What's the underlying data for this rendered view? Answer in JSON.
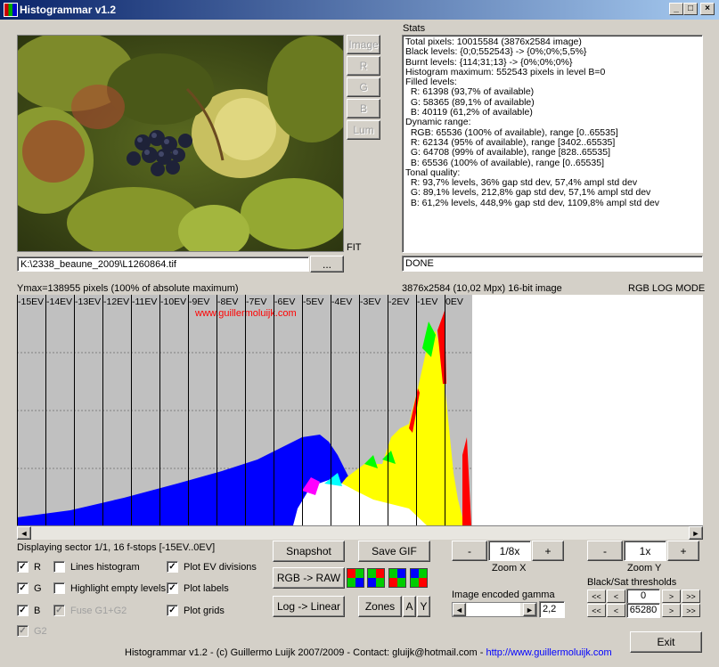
{
  "window": {
    "title": "Histogrammar v1.2",
    "controls": {
      "minimize": "_",
      "maximize": "□",
      "close": "×"
    }
  },
  "preview": {
    "side_buttons": [
      "Image",
      "R",
      "G",
      "B",
      "Lum"
    ],
    "fit_label": "FIT",
    "file_path": "K:\\2338_beaune_2009\\L1260864.tif",
    "browse_label": "..."
  },
  "stats": {
    "heading": "Stats",
    "lines": [
      "Total pixels: 10015584 (3876x2584 image)",
      "Black levels: {0;0;552543} -> {0%;0%;5,5%}",
      "Burnt levels: {114;31;13} -> {0%;0%;0%}",
      "Histogram maximum: 552543 pixels in level B=0",
      "",
      "Filled levels:",
      "  R: 61398 (93,7% of available)",
      "  G: 58365 (89,1% of available)",
      "  B: 40119 (61,2% of available)",
      "Dynamic range:",
      "  RGB: 65536 (100% of available), range [0..65535]",
      "  R: 62134 (95% of available), range [3402..65535]",
      "  G: 64708 (99% of available), range [828..65535]",
      "  B: 65536 (100% of available), range [0..65535]",
      "Tonal quality:",
      "  R: 93,7% levels, 36% gap std dev, 57,4% ampl std dev",
      "  G: 89,1% levels, 212,8% gap std dev, 57,1% ampl std dev",
      "  B: 61,2% levels, 448,9% gap std dev, 1109,8% ampl std dev"
    ],
    "status": "DONE"
  },
  "histogram": {
    "ymax_text": "Ymax=138955 pixels (100% of absolute maximum)",
    "image_info": "3876x2584 (10,02 Mpx) 16-bit image",
    "mode": "RGB LOG MODE",
    "watermark": "www.guillermoluijk.com",
    "ev_labels": [
      "-15EV",
      "-14EV",
      "-13EV",
      "-12EV",
      "-11EV",
      "-10EV",
      "-9EV",
      "-8EV",
      "-7EV",
      "-6EV",
      "-5EV",
      "-4EV",
      "-3EV",
      "-2EV",
      "-1EV",
      "0EV"
    ],
    "sector_text": "Displaying sector 1/1, 16 f-stops [-15EV..0EV]"
  },
  "options": {
    "r": "R",
    "g": "G",
    "b": "B",
    "g2": "G2",
    "lines_histogram": "Lines histogram",
    "highlight_empty": "Highlight empty levels",
    "fuse_g1g2": "Fuse G1+G2",
    "plot_ev": "Plot EV divisions",
    "plot_labels": "Plot labels",
    "plot_grids": "Plot grids"
  },
  "actions": {
    "snapshot": "Snapshot",
    "save_gif": "Save GIF",
    "rgb_raw": "RGB -> RAW",
    "log_linear": "Log -> Linear",
    "zones": "Zones",
    "a": "A",
    "y": "Y",
    "exit": "Exit"
  },
  "zoom_x": {
    "minus": "-",
    "value": "1/8x",
    "plus": "+",
    "label": "Zoom X"
  },
  "zoom_y": {
    "minus": "-",
    "value": "1x",
    "plus": "+",
    "label": "Zoom Y"
  },
  "gamma": {
    "label": "Image encoded gamma",
    "value": "2,2",
    "left": "◄",
    "right": "►"
  },
  "thresholds": {
    "label": "Black/Sat thresholds",
    "black": "0",
    "sat": "65280",
    "dec_fast": "<<",
    "dec": "<",
    "inc": ">",
    "inc_fast": ">>"
  },
  "footer": {
    "text": "Histogrammar v1.2 - (c) Guillermo Luijk 2007/2009 - Contact: gluijk@hotmail.com - ",
    "link": "http://www.guillermoluijk.com"
  },
  "colors": {
    "red": "#ff0000",
    "green": "#00ff00",
    "blue": "#0000ff",
    "yellow": "#ffff00",
    "title_start": "#0a246a",
    "title_end": "#a6caf0"
  }
}
